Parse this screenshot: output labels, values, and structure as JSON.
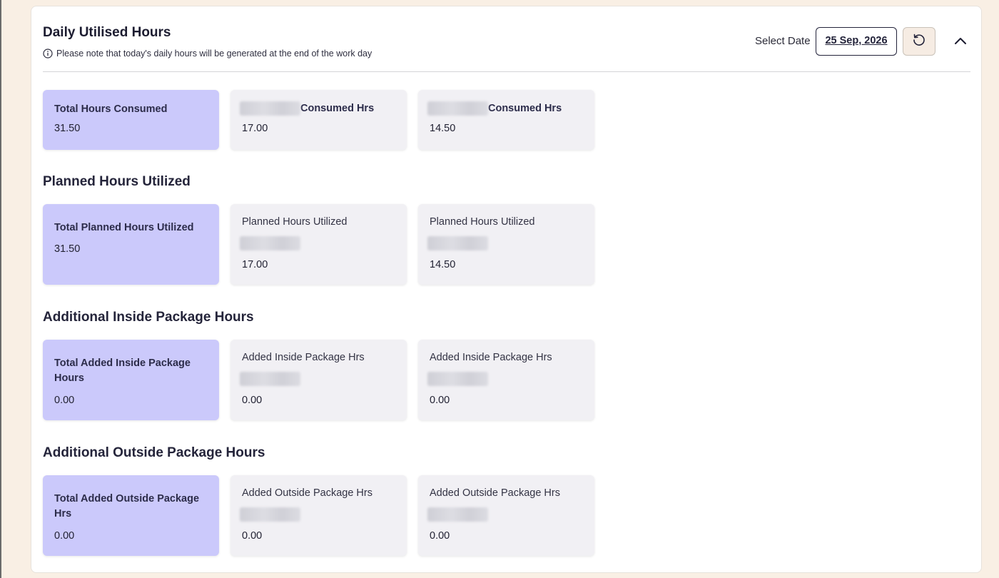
{
  "header": {
    "title": "Daily Utilised Hours",
    "note": "Please note that today's daily hours will be generated at the end of the work day",
    "select_label": "Select Date",
    "date_value": "25 Sep, 2026"
  },
  "sections": [
    {
      "title": "",
      "total": {
        "label": "Total Hours Consumed",
        "value": "31.50"
      },
      "items": [
        {
          "label": "Consumed Hrs",
          "value": "17.00"
        },
        {
          "label": "Consumed Hrs",
          "value": "14.50"
        }
      ]
    },
    {
      "title": "Planned Hours Utilized",
      "total": {
        "label": "Total Planned Hours Utilized",
        "value": "31.50"
      },
      "items": [
        {
          "label": "Planned Hours Utilized",
          "value": "17.00"
        },
        {
          "label": "Planned Hours Utilized",
          "value": "14.50"
        }
      ]
    },
    {
      "title": "Additional Inside Package Hours",
      "total": {
        "label": "Total Added Inside Package Hours",
        "value": "0.00"
      },
      "items": [
        {
          "label": "Added Inside Package Hrs",
          "value": "0.00"
        },
        {
          "label": "Added Inside Package Hrs",
          "value": "0.00"
        }
      ]
    },
    {
      "title": "Additional Outside Package Hours",
      "total": {
        "label": "Total Added Outside Package Hrs",
        "value": "0.00"
      },
      "items": [
        {
          "label": "Added Outside Package Hrs",
          "value": "0.00"
        },
        {
          "label": "Added Outside Package Hrs",
          "value": "0.00"
        }
      ]
    }
  ],
  "colors": {
    "total_card_bg": "#cbc9fb",
    "card_bg": "#f1f0f4",
    "page_bg": "#f9efe4"
  },
  "icons": {
    "note": "info-icon",
    "reset": "refresh-icon",
    "collapse": "chevron-up-icon"
  }
}
